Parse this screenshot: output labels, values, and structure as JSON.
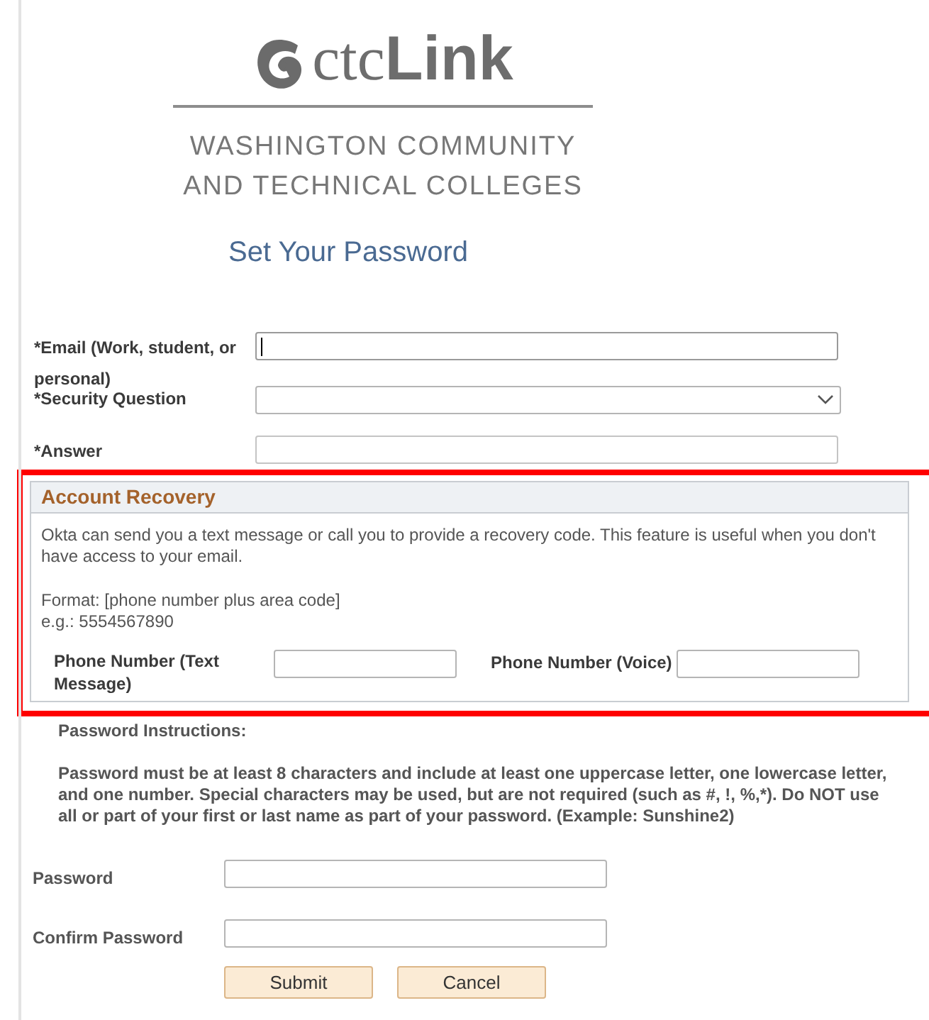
{
  "logo": {
    "serif_part": "ctc",
    "bold_part": "Link",
    "subtitle_lines": [
      "WASHINGTON COMMUNITY",
      "AND TECHNICAL COLLEGES"
    ]
  },
  "page_title": "Set Your Password",
  "top_fields": [
    {
      "label": "*Email (Work, student, or personal)",
      "kind": "text",
      "focused": true
    },
    {
      "label": "*Security Question",
      "kind": "select",
      "focused": false
    },
    {
      "label": "*Answer",
      "kind": "text",
      "focused": false
    }
  ],
  "account_recovery": {
    "highlighted": true,
    "title": "Account Recovery",
    "description": "Okta can send you a text message or call you to provide a recovery code. This feature is useful when you don't have access to your email.",
    "format_lines": [
      "Format: [phone number plus area code]",
      "e.g.: 5554567890"
    ],
    "phone_fields": [
      {
        "label": "Phone Number (Text Message)"
      },
      {
        "label": "Phone Number (Voice)"
      }
    ]
  },
  "password_instructions": {
    "heading": "Password Instructions:",
    "text": "Password must be at least 8 characters and include at least one uppercase letter, one lowercase letter, and one number. Special characters may be used, but are not required (such as #, !, %,*). Do NOT use all or part of your first or last name as part of your password. (Example: Sunshine2)"
  },
  "password_fields": [
    {
      "label": "Password"
    },
    {
      "label": "Confirm Password"
    }
  ],
  "buttons": [
    "Submit",
    "Cancel"
  ]
}
